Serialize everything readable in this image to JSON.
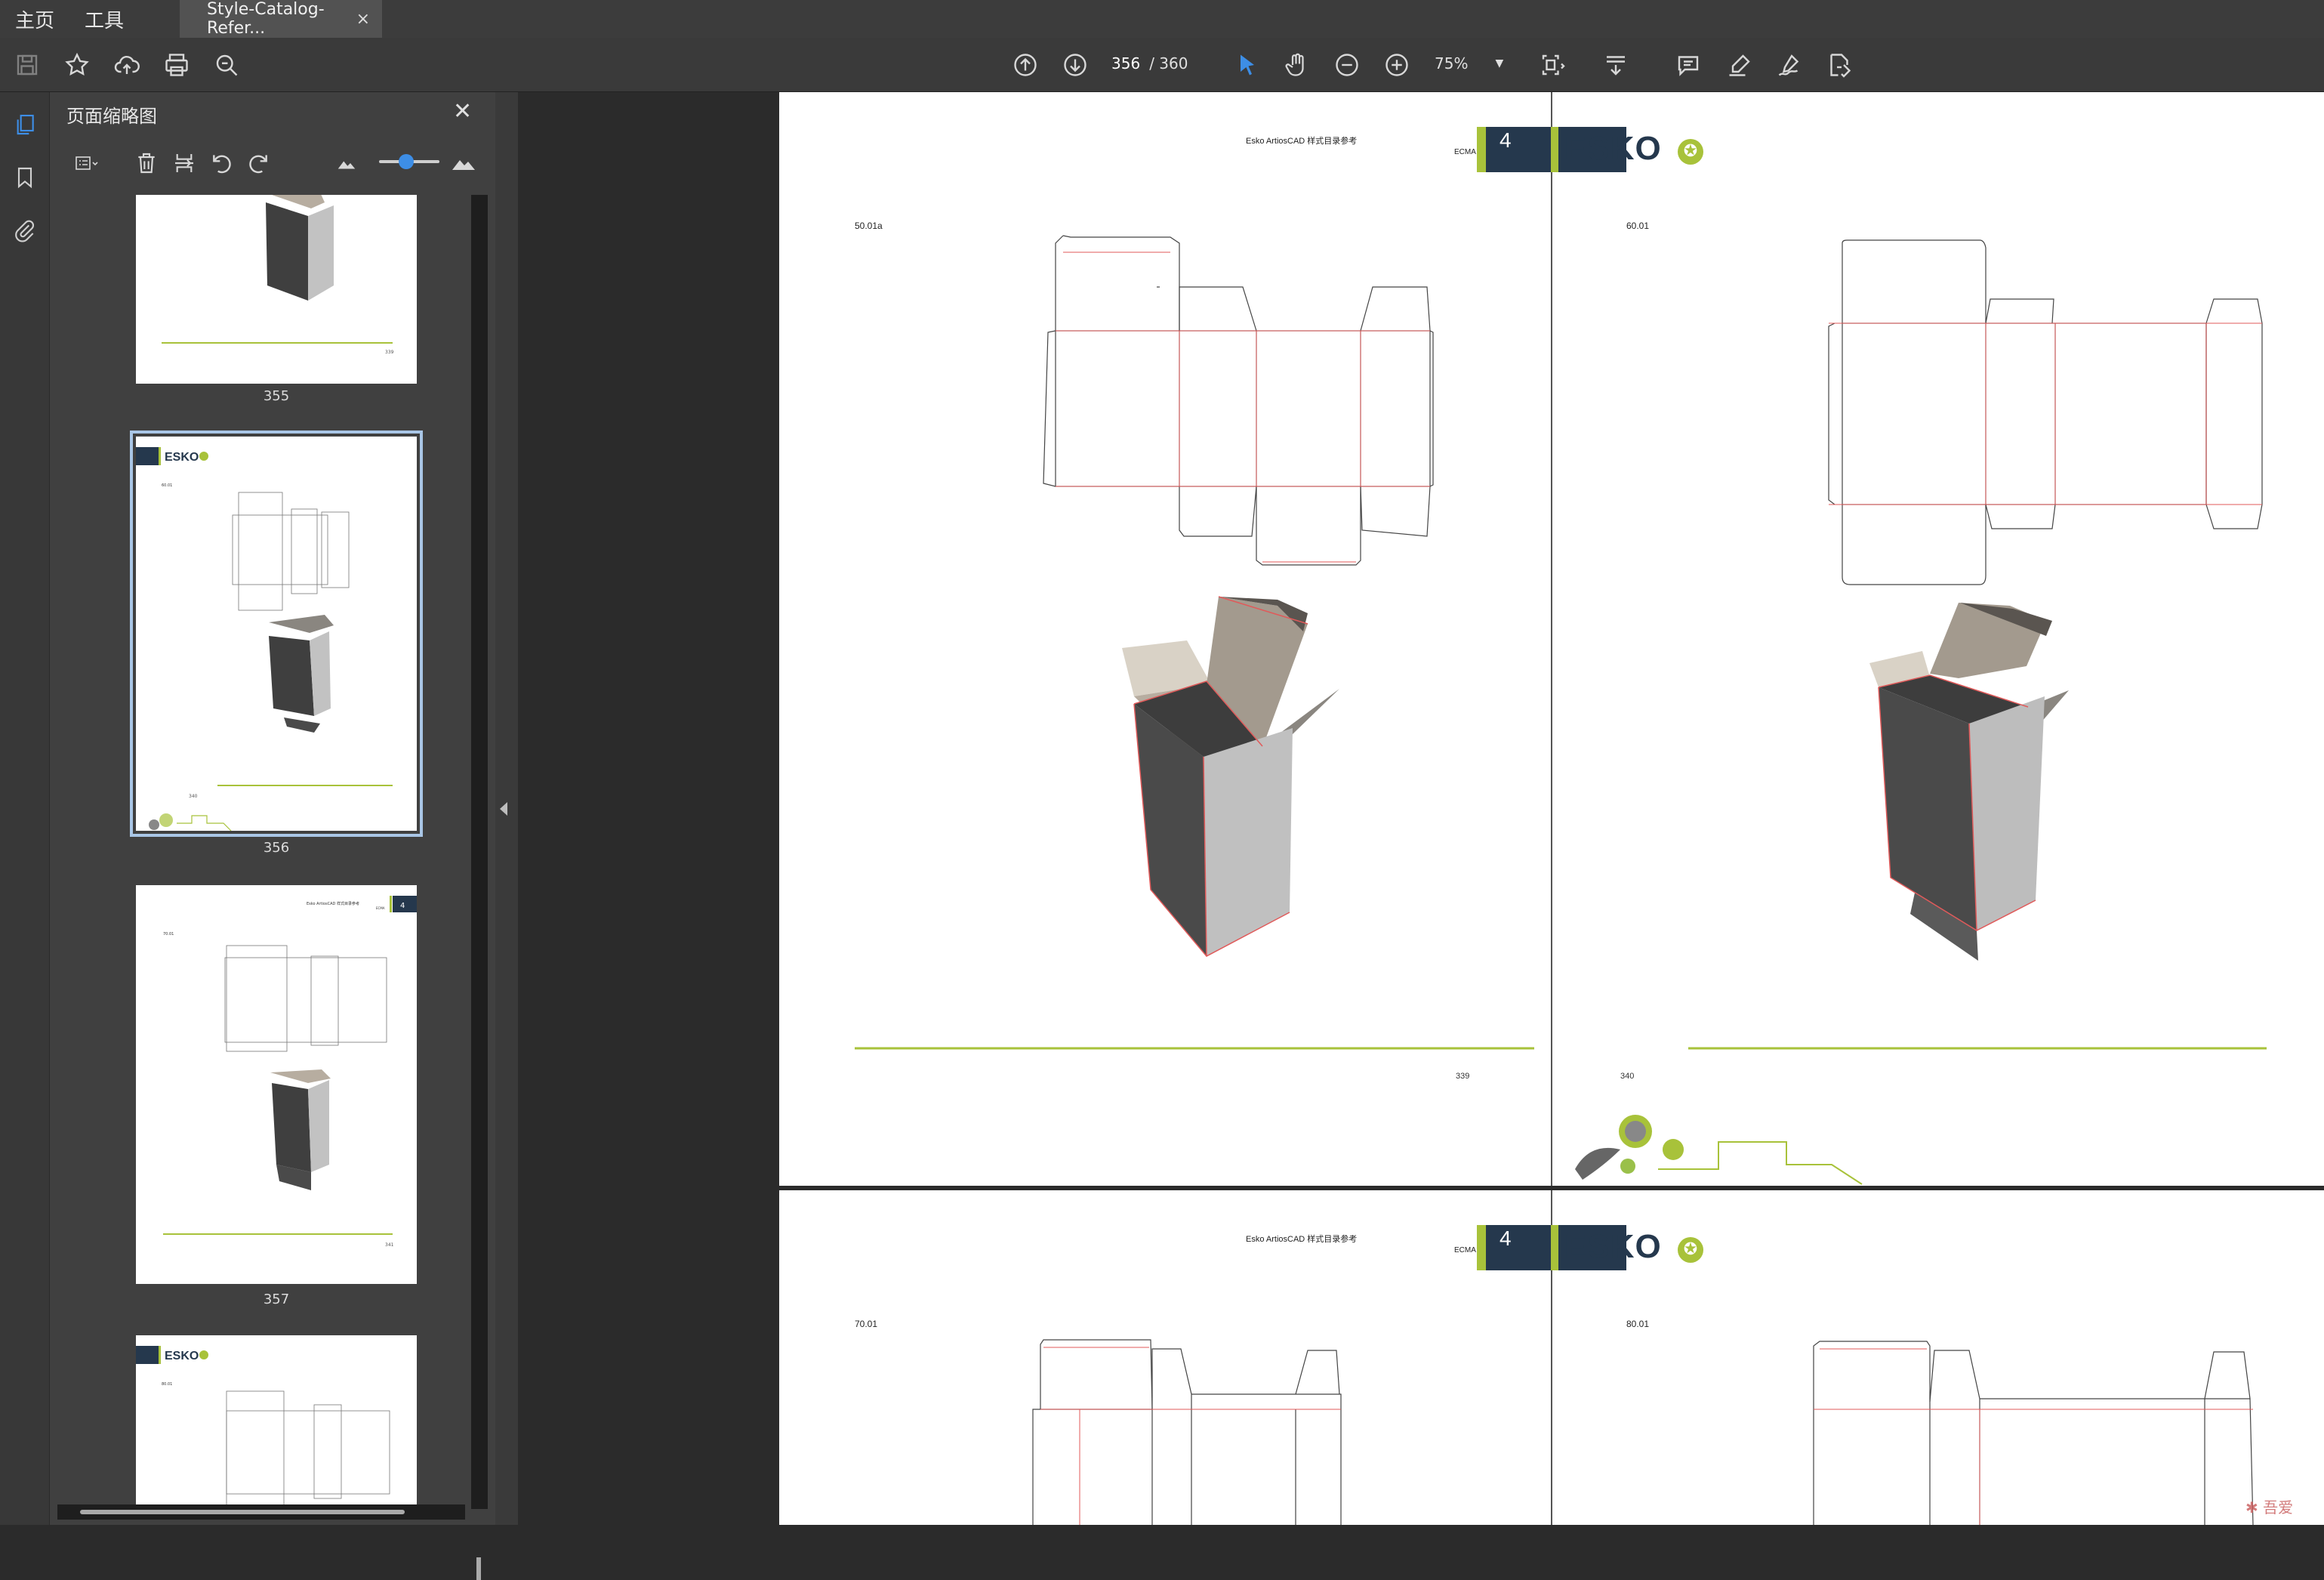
{
  "menubar": {
    "home": "主页",
    "tools": "工具",
    "tab_title": "Style-Catalog-Refer...",
    "tab_close": "×"
  },
  "toolbar": {
    "left_icons": [
      "save-icon",
      "star-icon",
      "upload-cloud-icon",
      "print-icon",
      "find-zoom-icon"
    ],
    "nav_icons": [
      "page-up-icon",
      "page-down-icon"
    ],
    "page_current": "356",
    "page_total": "/ 360",
    "tool_icons": [
      "select-arrow-icon",
      "hand-icon",
      "zoom-out-icon",
      "zoom-in-icon"
    ],
    "zoom_level": "75%",
    "right_icons": [
      "fit-page-icon",
      "scroll-mode-icon",
      "comment-icon",
      "highlight-pen-icon",
      "sign-icon",
      "edit-pdf-icon"
    ]
  },
  "navrail": {
    "icons": [
      "page-thumbnails-icon",
      "bookmark-icon",
      "attachment-icon"
    ]
  },
  "thumb_panel": {
    "title": "页面缩略图",
    "close": "✕",
    "tools": [
      "options-menu-icon",
      "delete-page-icon",
      "insert-page-icon",
      "rotate-left-icon",
      "rotate-right-icon",
      "small-thumbnail-icon",
      "large-thumbnail-icon"
    ],
    "slider_value": 0.45,
    "pages": [
      {
        "label": "355",
        "selected": false
      },
      {
        "label": "356",
        "selected": true
      },
      {
        "label": "357",
        "selected": false
      },
      {
        "label": "",
        "selected": false
      }
    ]
  },
  "doc": {
    "spread1": {
      "header_title": "Esko ArtiosCAD 样式目录参考",
      "ecma": "ECMA",
      "section_num": "4",
      "brand": "ESKO",
      "left_code": "50.01a",
      "right_code": "60.01",
      "left_page": "339",
      "right_page": "340"
    },
    "spread2": {
      "header_title": "Esko ArtiosCAD 样式目录参考",
      "ecma": "ECMA",
      "section_num": "4",
      "brand": "ESKO",
      "left_code": "70.01",
      "right_code": "80.01"
    }
  },
  "colors": {
    "brand_navy": "#25384d",
    "brand_green": "#a8c23a",
    "cut_line": "#e05a5a"
  }
}
